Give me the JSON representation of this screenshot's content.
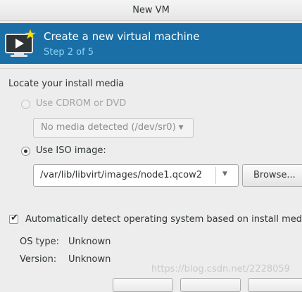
{
  "window": {
    "title": "New VM"
  },
  "header": {
    "title": "Create a new virtual machine",
    "step": "Step 2 of 5",
    "icon": "monitor-play-icon"
  },
  "install_media": {
    "label": "Locate your install media",
    "options": [
      {
        "label": "Use CDROM or DVD",
        "selected": false,
        "enabled": false
      },
      {
        "label": "Use ISO image:",
        "selected": true,
        "enabled": true
      }
    ],
    "cdrom_combo": {
      "value": "No media detected (/dev/sr0)",
      "enabled": false
    },
    "iso_path": {
      "value": "/var/lib/libvirt/images/node1.qcow2"
    },
    "browse_label": "Browse..."
  },
  "os_detect": {
    "checkbox_label": "Automatically detect operating system based on install medi",
    "checked": true,
    "os_type_label": "OS type:",
    "os_type_value": "Unknown",
    "version_label": "Version:",
    "version_value": "Unknown"
  },
  "watermark": "https://blog.csdn.net/2228059",
  "colors": {
    "accent": "#1a6fa7",
    "step_text": "#8ed3f7"
  }
}
